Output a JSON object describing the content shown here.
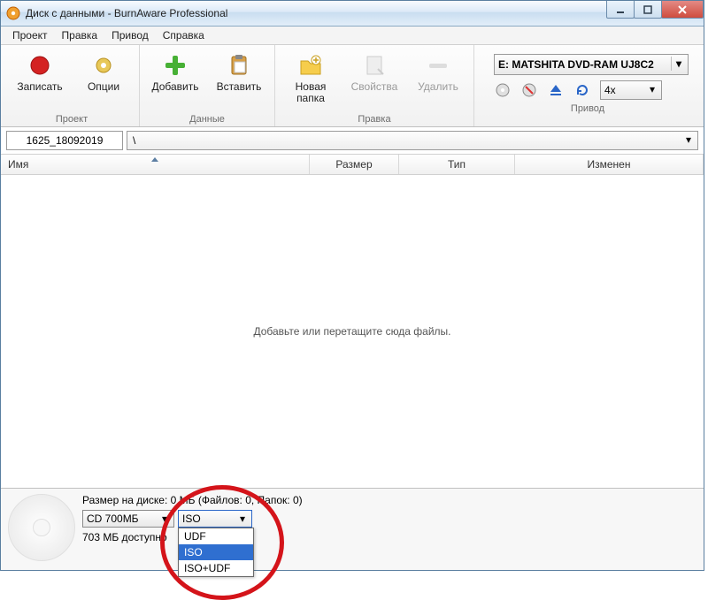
{
  "titlebar": {
    "title": "Диск с данными - BurnAware Professional"
  },
  "menubar": {
    "items": [
      "Проект",
      "Правка",
      "Привод",
      "Справка"
    ]
  },
  "ribbon": {
    "groups": {
      "project": {
        "label": "Проект",
        "buttons": {
          "record": "Записать",
          "options": "Опции"
        }
      },
      "data": {
        "label": "Данные",
        "buttons": {
          "add": "Добавить",
          "paste": "Вставить"
        }
      },
      "edit": {
        "label": "Правка",
        "buttons": {
          "newfolder_l1": "Новая",
          "newfolder_l2": "папка",
          "properties": "Свойства",
          "delete": "Удалить"
        }
      },
      "drive": {
        "label": "Привод",
        "device": "E: MATSHITA DVD-RAM UJ8C2",
        "speed": "4x"
      }
    }
  },
  "pathbar": {
    "discname": "1625_18092019",
    "path": "\\"
  },
  "columns": {
    "name": "Имя",
    "size": "Размер",
    "type": "Тип",
    "modified": "Изменен"
  },
  "filearea": {
    "placeholder": "Добавьте или перетащите сюда файлы."
  },
  "status": {
    "disksize_line": "Размер на диске: 0 МБ (Файлов: 0, Папок: 0)",
    "disc_capacity": "CD 700МБ",
    "filesystem_selected": "ISO",
    "filesystem_options": [
      "UDF",
      "ISO",
      "ISO+UDF"
    ],
    "available": "703 МБ доступно"
  }
}
